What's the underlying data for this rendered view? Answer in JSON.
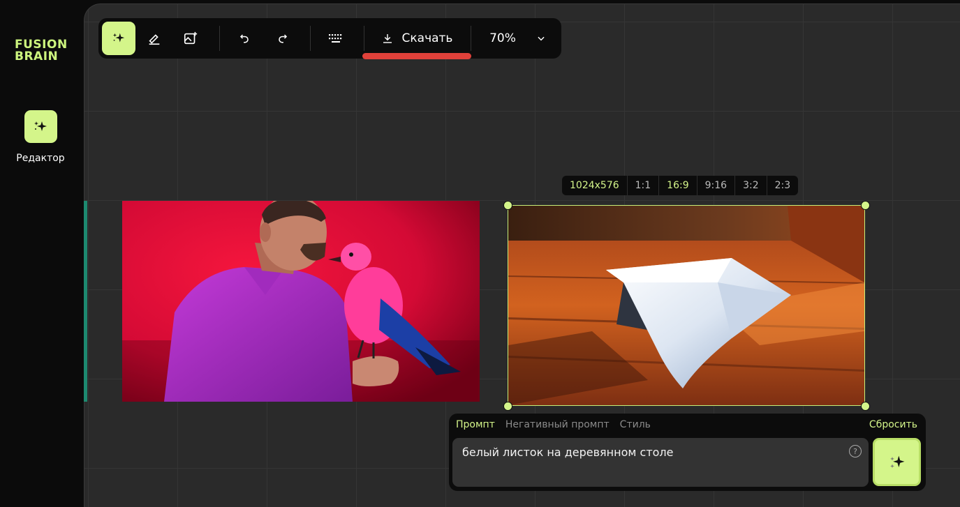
{
  "brand": {
    "line1": "FUSION",
    "line2": "BRAIN"
  },
  "sidebar": {
    "editor_label": "Редактор"
  },
  "toolbar": {
    "tools": [
      "sparkle-icon",
      "eraser-icon",
      "add-image-icon",
      "undo-icon",
      "redo-icon",
      "keyboard-icon"
    ],
    "download_label": "Скачать",
    "zoom": "70%"
  },
  "ratios": {
    "items": [
      "1024x576",
      "1:1",
      "16:9",
      "9:16",
      "3:2",
      "2:3"
    ],
    "selected": "16:9"
  },
  "prompt": {
    "tabs": [
      "Промпт",
      "Негативный промпт",
      "Стиль"
    ],
    "active_tab": "Промпт",
    "reset_label": "Сбросить",
    "value": "белый листок на деревянном столе",
    "help": "?"
  },
  "colors": {
    "accent": "#d4f58a",
    "download_bar": "#e0413a",
    "canvas": "#2a2a2a"
  }
}
